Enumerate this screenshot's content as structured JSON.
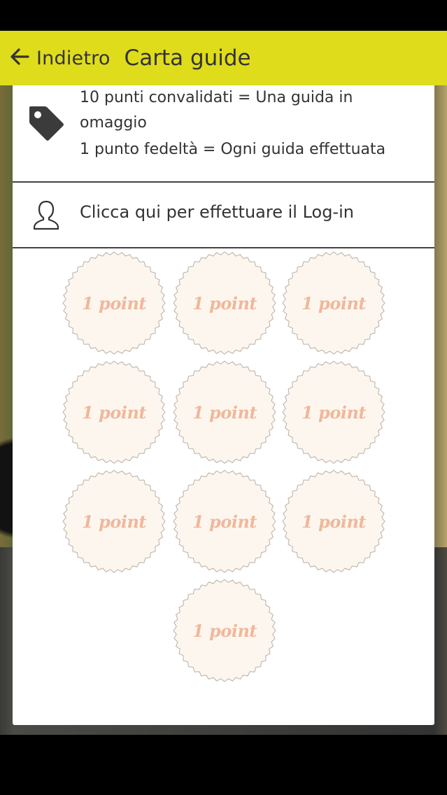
{
  "app_bar": {
    "back_label": "Indietro",
    "title": "Carta guide"
  },
  "info": {
    "line1": "10 punti convalidati = Una guida in",
    "line2": "omaggio",
    "line3": "1 punto fedeltà = Ogni guida effettuata"
  },
  "login": {
    "label": "Clicca qui per effettuare il Log-in"
  },
  "stamps": {
    "count": 10,
    "labels": [
      "1 point",
      "1 point",
      "1 point",
      "1 point",
      "1 point",
      "1 point",
      "1 point",
      "1 point",
      "1 point",
      "1 point"
    ]
  },
  "colors": {
    "app_bar": "#dfdc1c",
    "stamp_fill": "#fdf6ee",
    "stamp_text": "#efb89c"
  },
  "icons": {
    "back": "arrow-left-icon",
    "tag": "tag-icon",
    "user": "user-outline-icon"
  }
}
